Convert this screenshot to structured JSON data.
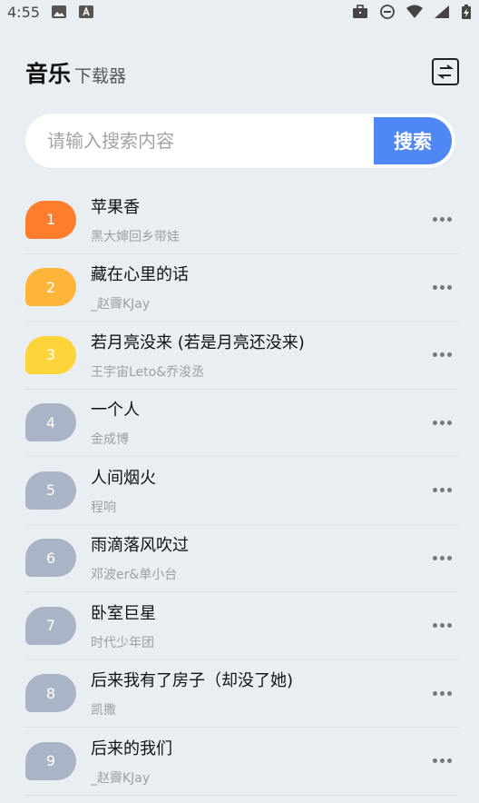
{
  "status_bar": {
    "time": "4:55"
  },
  "header": {
    "title": "音乐",
    "subtitle": "下载器"
  },
  "search": {
    "placeholder": "请输入搜索内容",
    "button_label": "搜索"
  },
  "colors": {
    "rank1": "#ff7d2d",
    "rank2": "#ffb43a",
    "rank3": "#ffd43b",
    "rank_default": "#a9b5c6",
    "accent": "#4f88f5"
  },
  "songs": [
    {
      "rank": "1",
      "title": "苹果香",
      "artist": "黑大婶回乡带娃"
    },
    {
      "rank": "2",
      "title": "藏在心里的话",
      "artist": "_赵霽KJay"
    },
    {
      "rank": "3",
      "title": "若月亮没来 (若是月亮还没来)",
      "artist": "王宇宙Leto&乔浚丞"
    },
    {
      "rank": "4",
      "title": "一个人",
      "artist": "金成博"
    },
    {
      "rank": "5",
      "title": "人间烟火",
      "artist": "程响"
    },
    {
      "rank": "6",
      "title": "雨滴落风吹过",
      "artist": "邓波er&单小台"
    },
    {
      "rank": "7",
      "title": "卧室巨星",
      "artist": "时代少年团"
    },
    {
      "rank": "8",
      "title": "后来我有了房子（却没了她)",
      "artist": "凯撒"
    },
    {
      "rank": "9",
      "title": "后来的我们",
      "artist": "_赵霽KJay"
    }
  ]
}
